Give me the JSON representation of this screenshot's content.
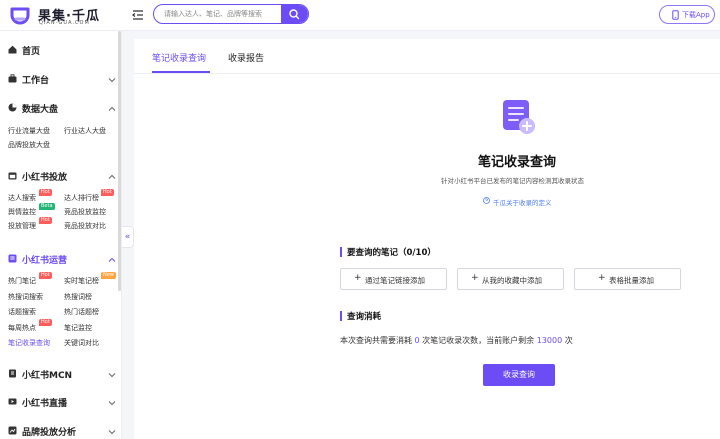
{
  "header": {
    "logo_cn": "果集·千瓜",
    "logo_en": "QIAN-GUA.COM",
    "search_placeholder": "请输入达人、笔记、品牌等搜索",
    "download_label": "下载App",
    "accent": "#6b4cf5"
  },
  "sidebar": {
    "sections": [
      {
        "label": "首页",
        "icon": "home-icon"
      },
      {
        "label": "工作台",
        "icon": "briefcase-icon"
      },
      {
        "label": "数据大盘",
        "icon": "pie-chart-icon",
        "items": [
          "行业流量大盘",
          "行业达人大盘",
          "品牌投放大盘"
        ]
      },
      {
        "label": "小红书投放",
        "icon": "calendar-icon",
        "items": [
          "达人搜索",
          "达人排行榜",
          "舆情监控",
          "竞品投放监控",
          "投放管理",
          "竞品投放对比"
        ]
      },
      {
        "label": "小红书运营",
        "icon": "notebook-icon",
        "items": [
          "热门笔记",
          "实时笔记榜",
          "热搜词搜索",
          "热搜词榜",
          "话题搜索",
          "热门话题榜",
          "每周热点",
          "笔记监控",
          "笔记收录查询",
          "关键词对比"
        ]
      },
      {
        "label": "小红书MCN",
        "icon": "building-icon"
      },
      {
        "label": "小红书直播",
        "icon": "live-video-icon"
      },
      {
        "label": "品牌投放分析",
        "icon": "analysis-icon"
      }
    ],
    "badges": {
      "hot": "Hot",
      "beta": "Beta",
      "new": "New"
    },
    "expand_glyph": "«"
  },
  "main": {
    "tabs": [
      {
        "label": "笔记收录查询",
        "active": true
      },
      {
        "label": "收录报告",
        "active": false
      }
    ],
    "title": "笔记收录查询",
    "subtitle": "针对小红书平台已发布的笔记内容检测其收录状态",
    "help_link": "千瓜关于收录的定义",
    "notes_section": {
      "label": "要查询的笔记",
      "count": "（0/10）",
      "buttons": [
        "通过笔记链接添加",
        "从我的收藏中添加",
        "表格批量添加"
      ]
    },
    "cost_section": {
      "label": "查询消耗",
      "text_prefix": "本次查询共需要消耗 ",
      "cost": "0",
      "text_mid": " 次笔记收录次数，当前账户剩余 ",
      "remaining": "13000",
      "text_suffix": " 次"
    },
    "submit_label": "收录查询"
  }
}
